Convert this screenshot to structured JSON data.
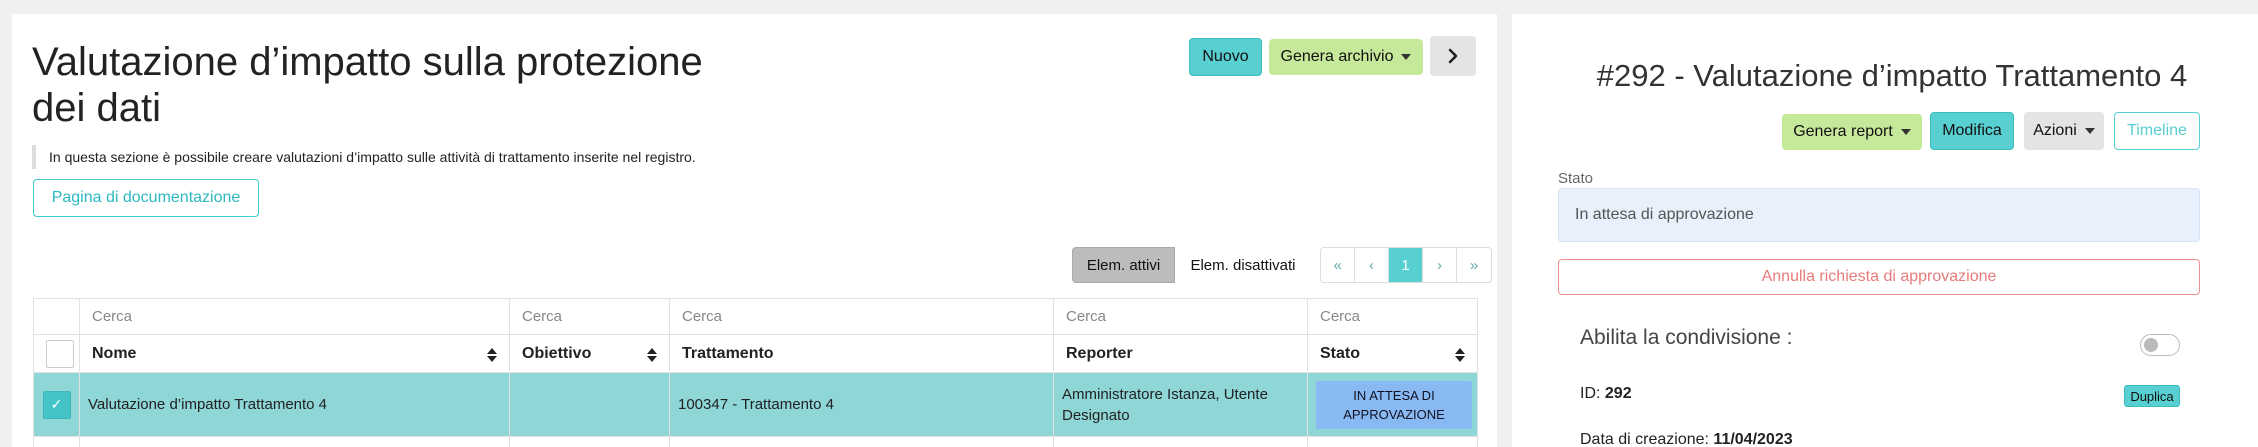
{
  "left": {
    "title": "Valutazione d’impatto sulla protezione dei dati",
    "description": "In questa sezione è possibile creare valutazioni d’impatto sulle attività di trattamento inserite nel registro.",
    "doc_button": "Pagina di documentazione",
    "toolbar": {
      "new_label": "Nuovo",
      "archive_label": "Genera archivio",
      "next_icon": "chevron-right-icon"
    },
    "filters": {
      "active_label": "Elem. attivi",
      "inactive_label": "Elem. disattivati"
    },
    "pager": {
      "first": "«",
      "prev": "‹",
      "current": "1",
      "next": "›",
      "last": "»"
    },
    "table": {
      "search_placeholder": "Cerca",
      "columns": [
        "Nome",
        "Obiettivo",
        "Trattamento",
        "Reporter",
        "Stato"
      ],
      "rows": [
        {
          "nome": "Valutazione d’impatto Trattamento 4",
          "obiettivo": "",
          "trattamento": "100347 - Trattamento 4",
          "reporter": "Amministratore Istanza, Utente Designato",
          "stato": "IN ATTESA DI APPROVAZIONE",
          "checkmark": "✓"
        }
      ]
    }
  },
  "right": {
    "title": "#292 - Valutazione d’impatto Trattamento 4",
    "buttons": {
      "report": "Genera report",
      "edit": "Modifica",
      "actions": "Azioni",
      "timeline": "Timeline"
    },
    "stato_label": "Stato",
    "stato_value": "In attesa di approvazione",
    "cancel_button": "Annulla richiesta di approvazione",
    "share_label": "Abilita la condivisione :",
    "id_label": "ID:",
    "id_value": "292",
    "duplicate_button": "Duplica",
    "created_label": "Data di creazione:",
    "created_value": "11/04/2023"
  },
  "colors": {
    "accent": "#58cfd0",
    "lime": "#c5e89b",
    "selected_row": "#8fd6d6",
    "status_badge": "#89b9f2",
    "danger": "#e87b7b"
  }
}
